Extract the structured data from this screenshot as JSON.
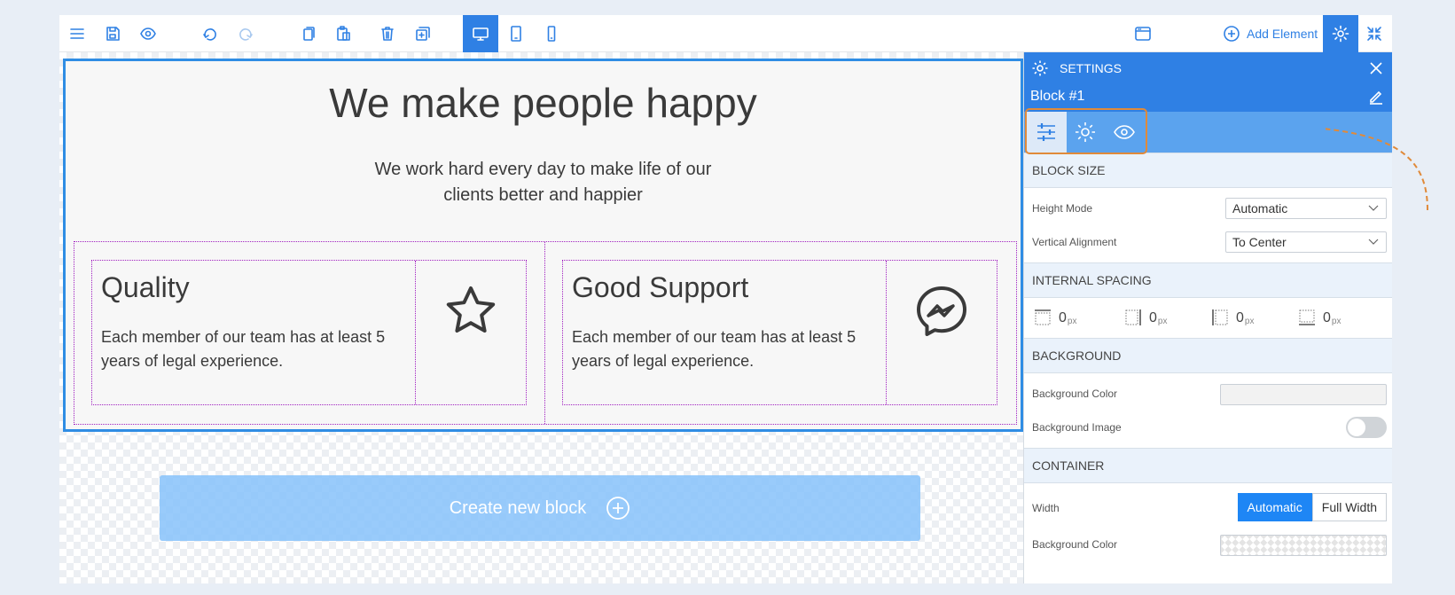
{
  "toolbar": {
    "add_element_label": "Add Element"
  },
  "canvas": {
    "block_title": "We make people happy",
    "block_subtitle_line1": "We work hard every day to make life of our",
    "block_subtitle_line2": "clients better and happier",
    "features": [
      {
        "title": "Quality",
        "text_line1": "Each member of our team has at least 5",
        "text_line2": "years of legal experience.",
        "icon": "star-icon"
      },
      {
        "title": "Good Support",
        "text_line1": "Each member of our team has at least 5",
        "text_line2": "years of legal experience.",
        "icon": "messenger-icon"
      }
    ],
    "create_block_label": "Create new block"
  },
  "settings": {
    "title": "SETTINGS",
    "block_name": "Block #1",
    "sections": {
      "block_size": "BLOCK SIZE",
      "internal_spacing": "INTERNAL SPACING",
      "background": "BACKGROUND",
      "container": "CONTAINER"
    },
    "height_mode": {
      "label": "Height Mode",
      "value": "Automatic"
    },
    "vertical_alignment": {
      "label": "Vertical Alignment",
      "value": "To Center"
    },
    "spacing": [
      {
        "value": "0",
        "unit": "px"
      },
      {
        "value": "0",
        "unit": "px"
      },
      {
        "value": "0",
        "unit": "px"
      },
      {
        "value": "0",
        "unit": "px"
      }
    ],
    "background_color_label": "Background Color",
    "background_image_label": "Background Image",
    "background_image_enabled": false,
    "width_label": "Width",
    "width_options": [
      "Automatic",
      "Full Width"
    ],
    "width_selected": "Automatic",
    "container_bg_label": "Background Color"
  },
  "colors": {
    "accent": "#2f80e4",
    "annotation": "#e08a3a"
  }
}
